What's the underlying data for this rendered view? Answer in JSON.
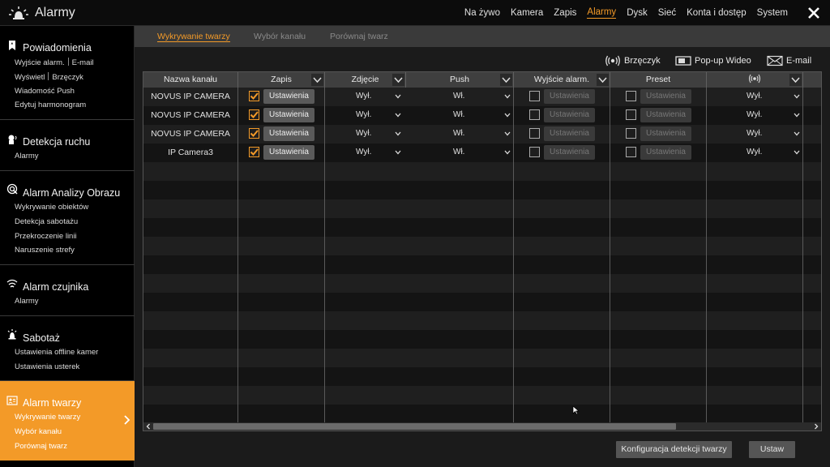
{
  "app": {
    "title": "Alarmy",
    "icon": "alarm-light-icon",
    "close_icon": "close-icon"
  },
  "topnav": [
    {
      "label": "Na żywo",
      "active": false
    },
    {
      "label": "Kamera",
      "active": false
    },
    {
      "label": "Zapis",
      "active": false
    },
    {
      "label": "Alarmy",
      "active": true
    },
    {
      "label": "Dysk",
      "active": false
    },
    {
      "label": "Sieć",
      "active": false
    },
    {
      "label": "Konta i dostęp",
      "active": false
    },
    {
      "label": "System",
      "active": false
    }
  ],
  "sidebar": {
    "groups": [
      {
        "title": "Powiadomienia",
        "icon": "bookmark-icon",
        "subs": [
          [
            "Wyjście alarm.",
            "E-mail"
          ],
          [
            "Wyświetl",
            "Brzęczyk"
          ],
          [
            "Wiadomość Push"
          ],
          [
            "Edytuj harmonogram"
          ]
        ]
      },
      {
        "title": "Detekcja ruchu",
        "icon": "motion-icon",
        "subs": [
          [
            "Alarmy"
          ]
        ]
      },
      {
        "title": "Alarm Analizy Obrazu",
        "icon": "analysis-icon",
        "subs": [
          [
            "Wykrywanie obiektów"
          ],
          [
            "Detekcja sabotażu"
          ],
          [
            "Przekroczenie linii"
          ],
          [
            "Naruszenie strefy"
          ]
        ]
      },
      {
        "title": "Alarm czujnika",
        "icon": "sensor-icon",
        "subs": [
          [
            "Alarmy"
          ]
        ]
      },
      {
        "title": "Sabotaż",
        "icon": "siren-icon",
        "subs": [
          [
            "Ustawienia offline kamer"
          ],
          [
            "Ustawienia usterek"
          ]
        ]
      },
      {
        "title": "Alarm twarzy",
        "icon": "face-id-icon",
        "active": true,
        "subs": [
          [
            "Wykrywanie twarzy"
          ],
          [
            "Wybór kanału"
          ],
          [
            "Porównaj twarz"
          ]
        ]
      }
    ]
  },
  "subtabs": [
    {
      "label": "Wykrywanie twarzy",
      "active": true
    },
    {
      "label": "Wybór kanału",
      "active": false
    },
    {
      "label": "Porównaj twarz",
      "active": false
    }
  ],
  "legend": {
    "buzzer": {
      "label": "Brzęczyk",
      "icon": "buzzer-icon"
    },
    "popup": {
      "label": "Pop-up Wideo",
      "icon": "popup-video-icon"
    },
    "email": {
      "label": "E-mail",
      "icon": "email-icon"
    }
  },
  "table": {
    "headers": [
      "Nazwa kanału",
      "Zapis",
      "Zdjęcie",
      "Push",
      "Wyjście alarm.",
      "Preset",
      ""
    ],
    "settings_label": "Ustawienia",
    "rows": [
      {
        "name": "NOVUS IP CAMERA",
        "record": true,
        "photo": "Wył.",
        "push": "Wł.",
        "alarm_out": false,
        "preset": false,
        "buzzer": "Wył."
      },
      {
        "name": "NOVUS IP CAMERA",
        "record": true,
        "photo": "Wył.",
        "push": "Wł.",
        "alarm_out": false,
        "preset": false,
        "buzzer": "Wył."
      },
      {
        "name": "NOVUS IP CAMERA",
        "record": true,
        "photo": "Wył.",
        "push": "Wł.",
        "alarm_out": false,
        "preset": false,
        "buzzer": "Wył."
      },
      {
        "name": "IP Camera3",
        "record": true,
        "photo": "Wył.",
        "push": "Wł.",
        "alarm_out": false,
        "preset": false,
        "buzzer": "Wył."
      }
    ]
  },
  "footer": {
    "config_button": "Konfiguracja detekcji twarzy",
    "apply_button": "Ustaw"
  },
  "colors": {
    "accent": "#f39a28",
    "topbar": "#0c0c0c",
    "sidebar": "#000000",
    "subtabs": "#3a3a3a"
  }
}
